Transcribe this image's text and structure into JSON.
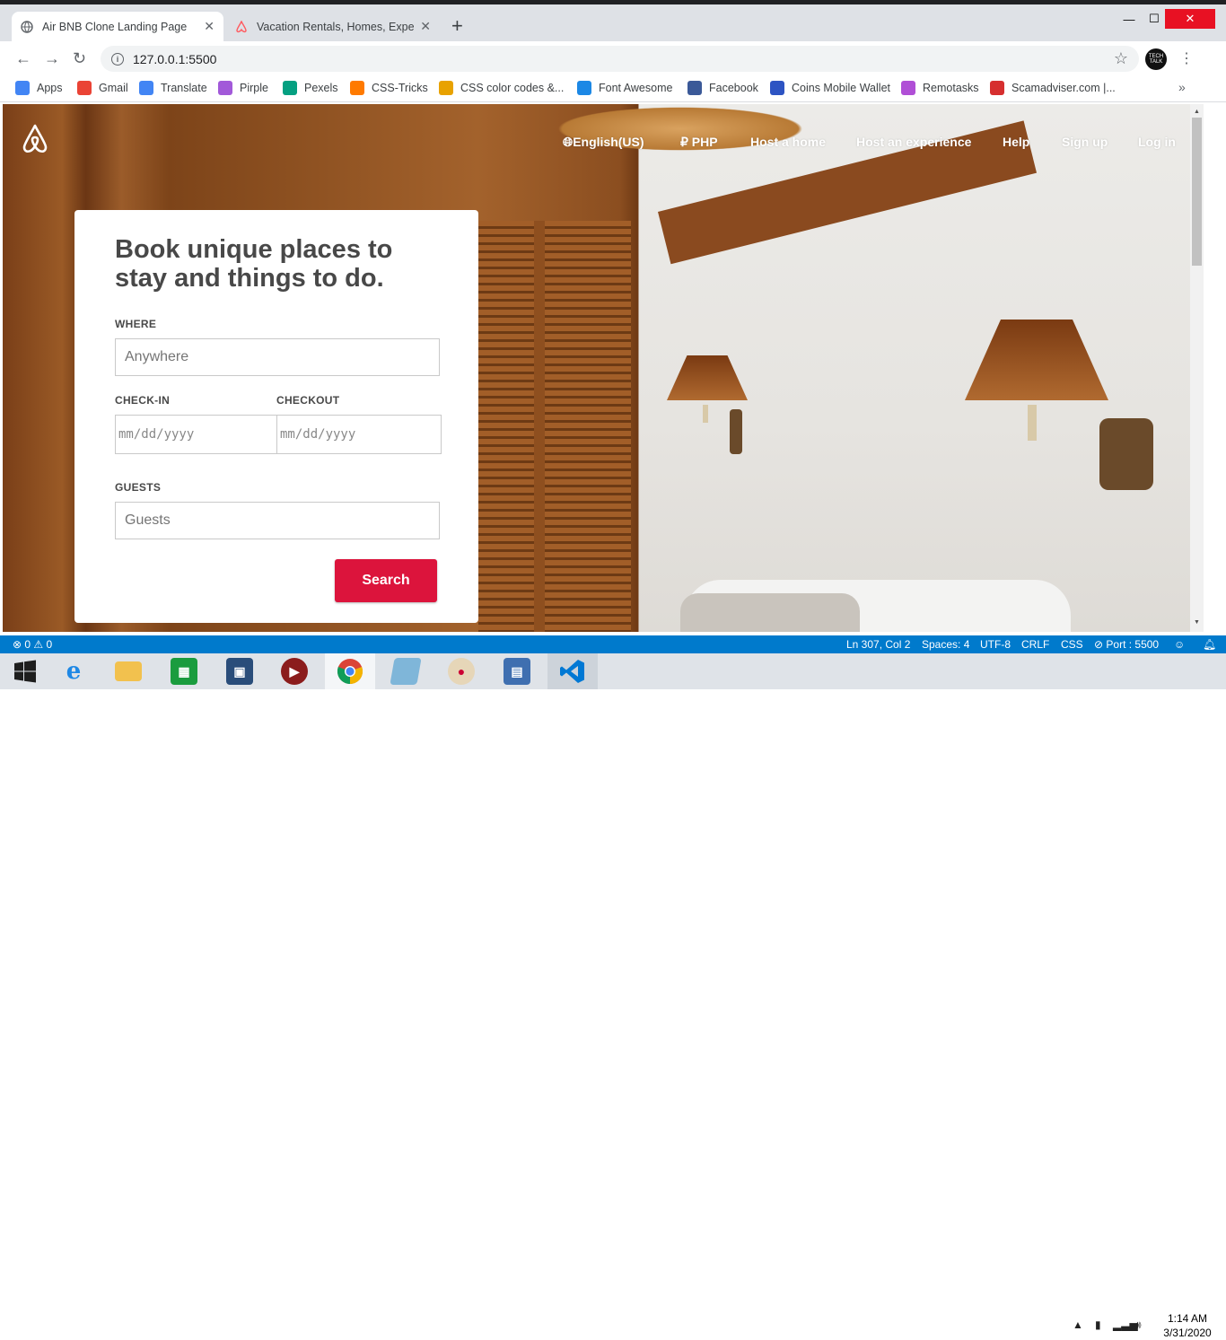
{
  "browser": {
    "tabs": [
      {
        "title": "Air BNB Clone Landing Page",
        "active": true
      },
      {
        "title": "Vacation Rentals, Homes, Experie",
        "active": false
      }
    ],
    "new_tab": "+",
    "window_controls": {
      "minimize": "—",
      "maximize": "☐",
      "close": "✕"
    },
    "url": "127.0.0.1:5500",
    "profile_text": "TECH TALK",
    "bookmarks": [
      {
        "label": "Apps",
        "icon": "apps-grid-icon",
        "color": "#4285f4"
      },
      {
        "label": "Gmail",
        "icon": "gmail-icon",
        "color": "#ea4335"
      },
      {
        "label": "Translate",
        "icon": "translate-icon",
        "color": "#4285f4"
      },
      {
        "label": "Pirple",
        "icon": "pirple-icon",
        "color": "#a259d9"
      },
      {
        "label": "Pexels",
        "icon": "pexels-icon",
        "color": "#05a081"
      },
      {
        "label": "CSS-Tricks",
        "icon": "css-tricks-icon",
        "color": "#ff7a00"
      },
      {
        "label": "CSS color codes &...",
        "icon": "css-color-codes-icon",
        "color": "#e8a200"
      },
      {
        "label": "Font Awesome",
        "icon": "font-awesome-icon",
        "color": "#1c88e5"
      },
      {
        "label": "Facebook",
        "icon": "facebook-icon",
        "color": "#3b5998"
      },
      {
        "label": "Coins Mobile Wallet",
        "icon": "coins-icon",
        "color": "#2d54c3"
      },
      {
        "label": "Remotasks",
        "icon": "remotasks-icon",
        "color": "#b04fd6"
      },
      {
        "label": "Scamadviser.com |...",
        "icon": "scamadviser-icon",
        "color": "#d62f2f"
      }
    ],
    "bookmarks_more": "»"
  },
  "page": {
    "nav": {
      "language": "English(US)",
      "currency": "₽ PHP",
      "host_home": "Host a home",
      "host_experience": "Host an experience",
      "help": "Help",
      "signup": "Sign up",
      "login": "Log in"
    },
    "card": {
      "heading": "Book unique places to stay and things to do.",
      "where_label": "WHERE",
      "where_placeholder": "Anywhere",
      "checkin_label": "CHECK-IN",
      "checkin_value": "mm/dd/yyyy",
      "checkout_label": "CHECKOUT",
      "checkout_value": "mm/dd/yyyy",
      "guests_label": "GUESTS",
      "guests_placeholder": "Guests",
      "search_button": "Search"
    }
  },
  "vscode_status": {
    "problems": "⊗ 0 ⚠ 0",
    "position": "Ln 307, Col 2",
    "spaces": "Spaces: 4",
    "encoding": "UTF-8",
    "eol": "CRLF",
    "language": "CSS",
    "port": "⊘ Port : 5500"
  },
  "taskbar": {
    "time": "1:14 AM",
    "date": "3/31/2020",
    "apps": [
      "windows-start-icon",
      "internet-explorer-icon",
      "file-explorer-icon",
      "store-icon",
      "remote-desktop-icon",
      "media-player-icon",
      "chrome-icon",
      "notepad-icon",
      "paint-icon",
      "network-computer-icon",
      "vscode-icon"
    ]
  },
  "colors": {
    "accent": "#dc143c",
    "status_bar": "#007acc",
    "close_button": "#e81123"
  }
}
